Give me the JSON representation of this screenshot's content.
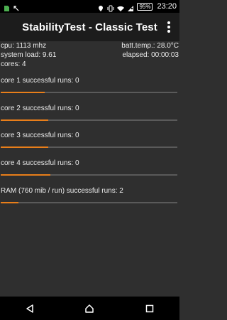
{
  "status_bar": {
    "icons": [
      "sd-card-icon",
      "data-transfer-icon",
      "location-icon",
      "vibrate-icon",
      "wifi-icon",
      "no-sim-icon"
    ],
    "battery": "95%",
    "time": "23:20"
  },
  "app_bar": {
    "title": "StabilityTest - Classic Test",
    "menu_icon": "overflow-menu-icon"
  },
  "info": {
    "cpu": "cpu: 1113 mhz",
    "batt_temp": "batt.temp.: 28.0°C",
    "system_load": "system load: 9.61",
    "elapsed": "elapsed: 00:00:03",
    "cores": "cores: 4"
  },
  "sections": [
    {
      "label": "core 1 successful runs: 0",
      "progress": 0.25
    },
    {
      "label": "core 2 successful runs: 0",
      "progress": 0.27
    },
    {
      "label": "core 3 successful runs: 0",
      "progress": 0.27
    },
    {
      "label": "core 4 successful runs: 0",
      "progress": 0.28
    },
    {
      "label": "RAM (760 mib / run) successful runs: 2",
      "progress": 0.1
    }
  ],
  "colors": {
    "accent": "#e87e1a",
    "track": "#5a5a5a",
    "background": "#2f2f2f",
    "app_bar": "#1c1c1c"
  },
  "nav_bar": {
    "icons": [
      "back-icon",
      "home-icon",
      "recents-icon"
    ]
  }
}
